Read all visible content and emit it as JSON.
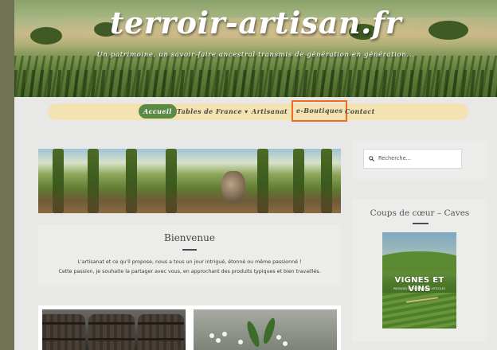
{
  "site": {
    "title": "terroir-artisan.fr",
    "tagline": "Un patrimoine, un savoir-faire ancestral transmis de génération en génération..."
  },
  "nav": {
    "items": [
      {
        "label": "Accueil",
        "active": true
      },
      {
        "label": "Tables de France",
        "has_dropdown": true
      },
      {
        "label": "Artisanat"
      },
      {
        "label": "e-Boutiques",
        "highlighted": true
      },
      {
        "label": "Contact"
      }
    ],
    "dropdown_glyph": "▾"
  },
  "welcome": {
    "title": "Bienvenue",
    "line1": "L'artisanat et ce qu'il propose, nous a tous un jour intrigué, étonné ou même passionné !",
    "line2": "Cette passion, je souhaite la partager avec vous, en approchant des produits typiques et bien travaillés."
  },
  "sidebar": {
    "search_placeholder": "Recherche...",
    "picks_title": "Coups de cœur – Caves",
    "book_title": "VIGNES ET VINS",
    "book_subtitle": "PAYSAGES ET PATRIMOINES VITICOLES"
  },
  "colors": {
    "nav_bg": "#f3e3b2",
    "nav_active": "#5b8a45",
    "highlight_border": "#ef6b22",
    "page_bg": "#e8e8e6",
    "outer_bg": "#6f7353"
  },
  "icons": {
    "search": "search-icon"
  }
}
